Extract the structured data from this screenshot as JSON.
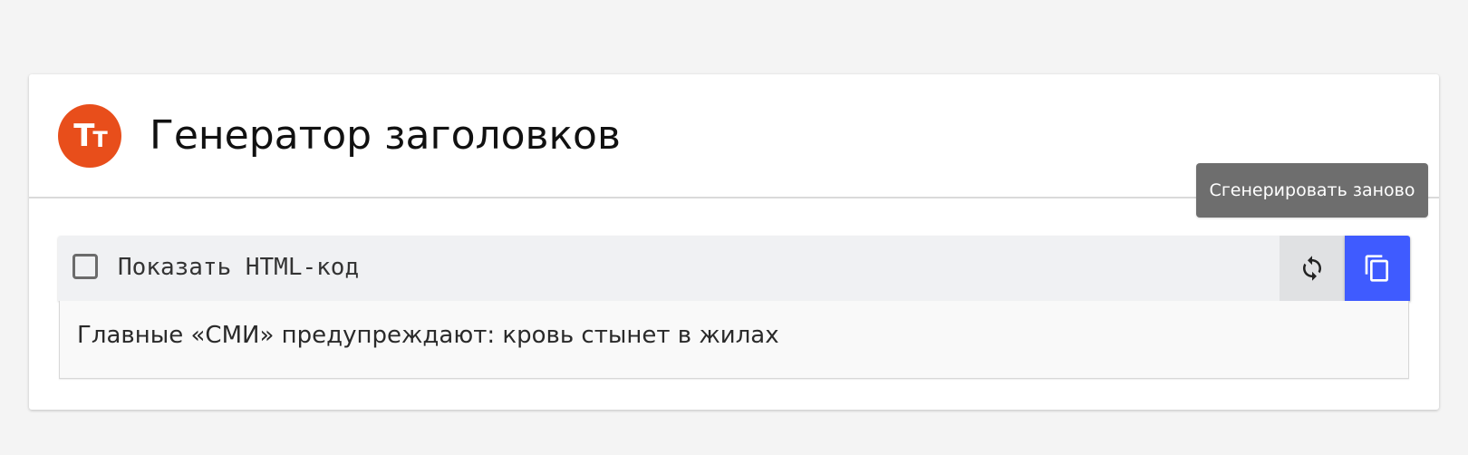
{
  "header": {
    "logo_big": "T",
    "logo_small": "T",
    "title": "Генератор заголовков"
  },
  "toolbar": {
    "checkbox_checked": false,
    "checkbox_label": "Показать HTML-код",
    "refresh_icon": "refresh-icon",
    "copy_icon": "copy-icon"
  },
  "tooltip": {
    "text": "Сгенерировать заново"
  },
  "result": {
    "headline": "Главные «СМИ» предупреждают: кровь стынет в жилах"
  },
  "colors": {
    "logo_bg": "#e84e1b",
    "copy_button_bg": "#3f5bff",
    "tooltip_bg": "#6e6e6e",
    "page_bg": "#f4f4f4"
  }
}
